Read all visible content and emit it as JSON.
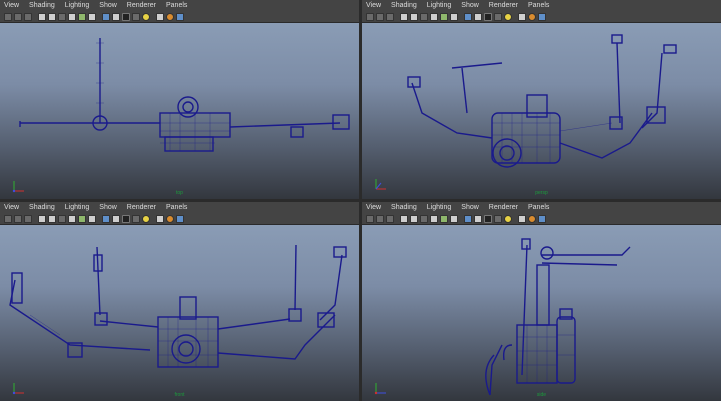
{
  "menu": [
    "View",
    "Shading",
    "Lighting",
    "Show",
    "Renderer",
    "Panels"
  ],
  "panels": [
    {
      "id": "top",
      "camera": "top"
    },
    {
      "id": "persp",
      "camera": "persp"
    },
    {
      "id": "front",
      "camera": "front"
    },
    {
      "id": "side",
      "camera": "side"
    }
  ],
  "colors": {
    "wireframe": "#1a1a8c",
    "axis_x": "#d03030",
    "axis_y": "#2fb02f",
    "axis_z": "#3f4fe0",
    "camera_label": "#1c9b3c"
  },
  "icons": [
    "select-camera-icon",
    "lock-camera-icon",
    "bookmark-icon",
    "image-plane-icon",
    "grid-icon",
    "film-gate-icon",
    "resolution-gate-icon",
    "safe-action-icon",
    "safe-title-icon",
    "wireframe-icon",
    "smooth-shade-icon",
    "bounding-box-icon",
    "texture-icon",
    "light-icon",
    "shadow-icon",
    "xray-icon",
    "isolate-icon"
  ]
}
